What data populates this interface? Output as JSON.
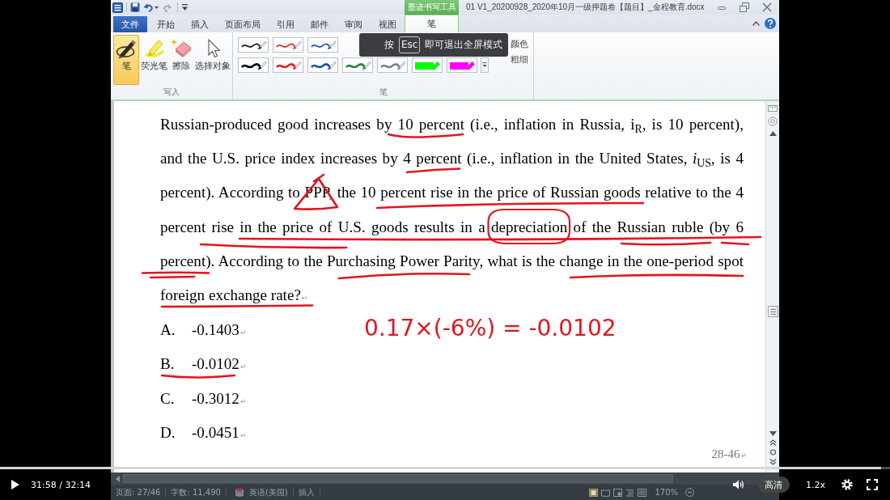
{
  "video_player": {
    "progress": {
      "level": 0.99
    },
    "time": "31:58 / 32:14",
    "quality": "高清",
    "speed": "1.2x"
  },
  "title_bar": {
    "context_group": "墨迹书写工具",
    "title": "01 V1_20200928_2020年10月一级押题卷【题目】_金程教育.docx"
  },
  "tabs": [
    {
      "label": "文件",
      "kind": "file",
      "selected": false
    },
    {
      "label": "开始",
      "kind": "normal",
      "selected": false
    },
    {
      "label": "插入",
      "kind": "normal",
      "selected": false
    },
    {
      "label": "页面布局",
      "kind": "normal",
      "selected": false
    },
    {
      "label": "引用",
      "kind": "normal",
      "selected": false
    },
    {
      "label": "邮件",
      "kind": "normal",
      "selected": false
    },
    {
      "label": "审阅",
      "kind": "normal",
      "selected": false
    },
    {
      "label": "视图",
      "kind": "normal",
      "selected": false
    },
    {
      "label": "笔",
      "kind": "contextual",
      "selected": true
    }
  ],
  "ribbon": {
    "write_group": {
      "label": "写入",
      "tools": [
        {
          "label": "笔",
          "kind": "pen",
          "selected": true
        },
        {
          "label": "荧光笔",
          "kind": "highlighter",
          "selected": false
        },
        {
          "label": "擦除",
          "kind": "eraser",
          "selected": false
        },
        {
          "label": "选择对象",
          "kind": "select",
          "selected": false
        }
      ]
    },
    "pen_group": {
      "label": "笔",
      "rows": [
        [
          {
            "kind": "thin",
            "color": "#222222"
          },
          {
            "kind": "thin",
            "color": "#e03038"
          },
          {
            "kind": "thin",
            "color": "#2a5caa"
          }
        ],
        [
          {
            "kind": "thick",
            "color": "#000000"
          },
          {
            "kind": "thick",
            "color": "#e0202a"
          },
          {
            "kind": "thick",
            "color": "#2050a0"
          },
          {
            "kind": "thick",
            "color": "#208040"
          },
          {
            "kind": "thick",
            "color": "#808080"
          },
          {
            "kind": "highlighter",
            "color": "#00ff00"
          },
          {
            "kind": "highlighter",
            "color": "#ff00ff"
          }
        ]
      ],
      "options": [
        "颜色",
        "粗细"
      ]
    }
  },
  "toast": {
    "before": "按",
    "key": "Esc",
    "after": "即可退出全屏模式"
  },
  "document": {
    "paragraph_lines": [
      "Russian-produced good increases by 10 percent (i.e., inflation in Russia, i$_{R}$, is 10 percent),",
      "and the U.S. price index increases by 4 percent (i.e., inflation in the United States, *i*$_{US}$, is 4",
      "percent). According to PPP, the 10 percent rise in the price of Russian goods relative to the 4",
      "percent rise in the price of U.S. goods results in a depreciation of the Russian ruble (by 6",
      "percent). According to the Purchasing Power Parity, what is the change in the one-period spot",
      "foreign exchange rate?"
    ],
    "paragraph_mark": "↵",
    "options": [
      {
        "letter": "A.",
        "value": "-0.1403",
        "mark": "↵"
      },
      {
        "letter": "B.",
        "value": "-0.0102",
        "mark": "↵"
      },
      {
        "letter": "C.",
        "value": "-0.3012",
        "mark": "↵"
      },
      {
        "letter": "D.",
        "value": "-0.0451",
        "mark": "↵"
      }
    ],
    "page_number": "28-46",
    "page_number_mark": "↵",
    "handwritten_note": "0.17×(-6%) = -0.0102"
  },
  "status_bar": {
    "page": "页面: 27/46",
    "words": "字数: 11,490",
    "language": "英语(美国)",
    "mode": "插入",
    "zoom": "170%"
  }
}
